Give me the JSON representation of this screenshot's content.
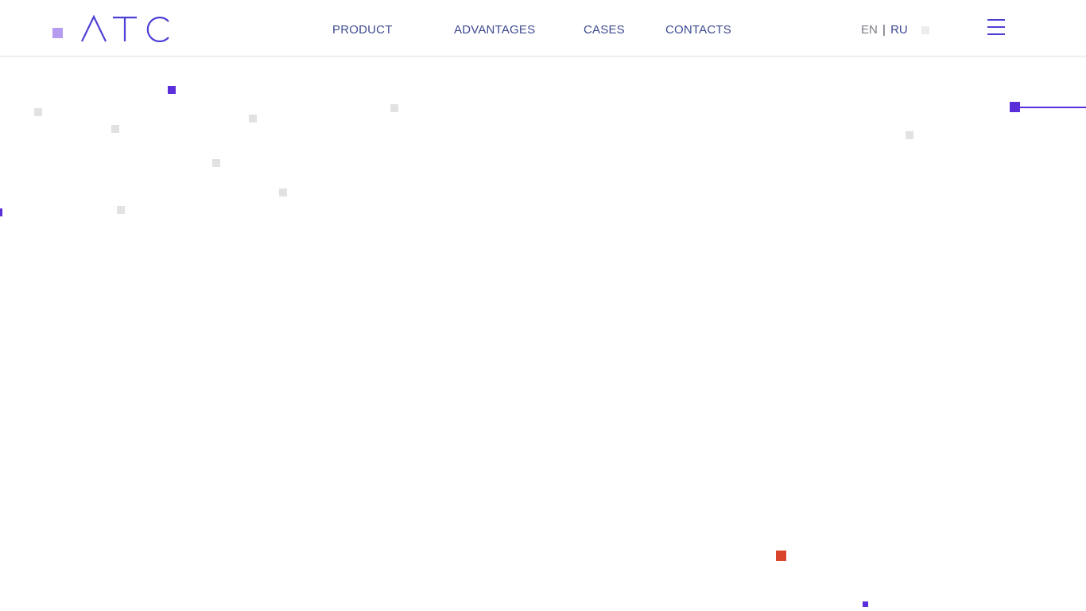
{
  "header": {
    "logo_text": "ATC",
    "nav": [
      {
        "label": "PRODUCT"
      },
      {
        "label": "ADVANTAGES"
      },
      {
        "label": "CASES"
      },
      {
        "label": "CONTACTS"
      }
    ],
    "lang": {
      "en": "EN",
      "separator": "|",
      "ru": "RU"
    }
  },
  "icons": {
    "menu": "hamburger-menu-icon"
  },
  "colors": {
    "accent": "#5a2fd9",
    "nav_text": "#3c4a8f",
    "logo_mark": "#b59cf0",
    "decor_gray": "#e2e2e2",
    "decor_red": "#d9452b"
  }
}
